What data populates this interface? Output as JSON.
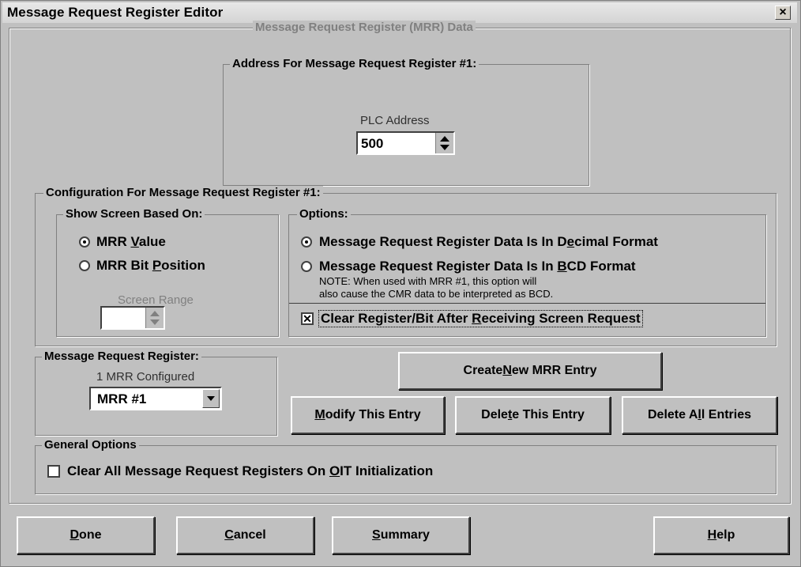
{
  "window": {
    "title": "Message Request Register Editor",
    "close_label": "×"
  },
  "mrr_data": {
    "legend": "Message Request Register (MRR) Data",
    "address_group": {
      "legend": "Address For Message Request Register #1:",
      "plc_address_label": "PLC Address",
      "plc_address_value": "500"
    }
  },
  "configuration": {
    "legend": "Configuration For Message Request Register #1:",
    "show_screen": {
      "legend": "Show Screen Based On:",
      "options": [
        {
          "pre": "MRR ",
          "key": "V",
          "post": "alue",
          "selected": true
        },
        {
          "pre": "MRR Bit ",
          "key": "P",
          "post": "osition",
          "selected": false
        }
      ],
      "screen_range_label": "Screen Range",
      "screen_range_value": ""
    },
    "options": {
      "legend": "Options:",
      "decimal": {
        "pre": "Message Request Register Data Is In D",
        "key": "e",
        "post": "cimal Format",
        "selected": true
      },
      "bcd": {
        "pre": "Message Request Register Data Is In ",
        "key": "B",
        "post": "CD Format",
        "selected": false
      },
      "note_line1": "NOTE: When used with MRR #1, this option will",
      "note_line2": "also cause the CMR data to be interpreted as BCD.",
      "clear_after": {
        "pre": "Clear Register/Bit After ",
        "key": "R",
        "post": "eceiving Screen Request",
        "checked": true
      }
    }
  },
  "mrr_selector": {
    "legend": "Message Request Register:",
    "configured_count": "1 MRR Configured",
    "selected": "MRR #1"
  },
  "entry_buttons": {
    "create": {
      "pre": "Create ",
      "key": "N",
      "post": "ew MRR Entry"
    },
    "modify": {
      "pre": "",
      "key": "M",
      "post": "odify This Entry"
    },
    "delete": {
      "pre": "Dele",
      "key": "t",
      "post": "e This Entry"
    },
    "delete_all": {
      "pre": "Delete A",
      "key": "l",
      "post": "l Entries"
    }
  },
  "general_options": {
    "legend": "General Options",
    "clear_all": {
      "pre": "Clear All Message Request Registers On ",
      "key": "O",
      "post": "IT Initialization",
      "checked": false
    }
  },
  "footer": {
    "done": {
      "pre": "",
      "key": "D",
      "post": "one"
    },
    "cancel": {
      "pre": "",
      "key": "C",
      "post": "ancel"
    },
    "summary": {
      "pre": "",
      "key": "S",
      "post": "ummary"
    },
    "help": {
      "pre": "",
      "key": "H",
      "post": "elp"
    }
  },
  "colors": {
    "face": "#c0c0c0",
    "shadow": "#808080",
    "disabled_text": "#808080"
  }
}
